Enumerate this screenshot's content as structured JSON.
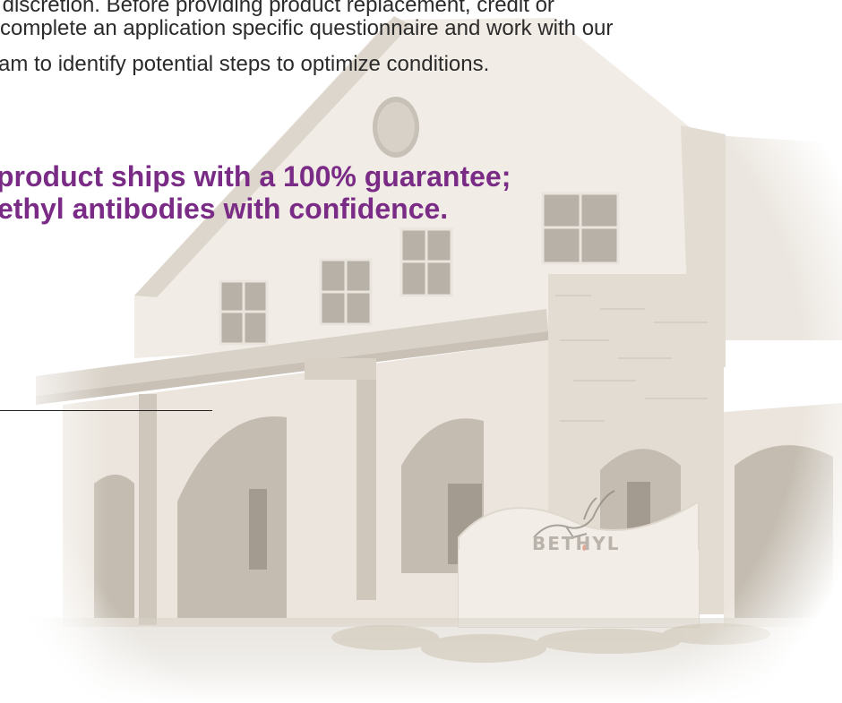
{
  "page": {
    "body_lines": [
      "or's discretion. Before providing product replacement, credit or",
      "complete an application specific questionnaire and work with our",
      "am to identify potential steps to optimize conditions."
    ],
    "guarantee_lines": [
      "product ships with a 100% guarantee;",
      "ethyl antibodies with confidence."
    ],
    "sign_text": "BETHYL"
  },
  "colors": {
    "body_text": "#2b2b2b",
    "accent_purple": "#7a2b86",
    "background": "#ffffff"
  },
  "icons": {
    "background_image": "building-photo-illustration",
    "sign_logo": "bethyl-deer-logo"
  }
}
